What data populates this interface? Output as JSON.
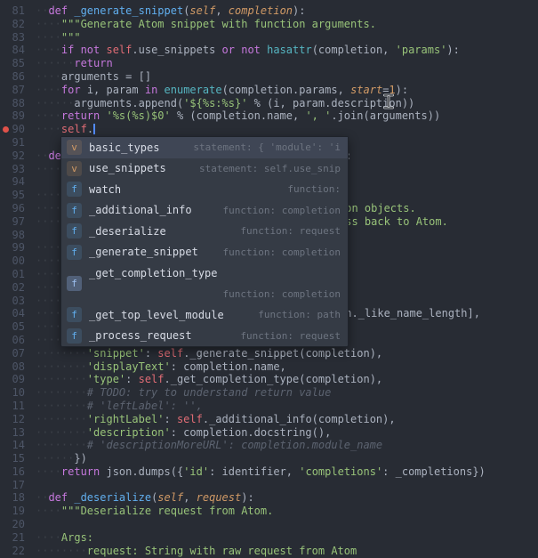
{
  "colors": {
    "background": "#282c34",
    "default_text": "#abb2bf",
    "keyword": "#c678dd",
    "function_name": "#61afef",
    "string": "#98c379",
    "constant": "#d19a66",
    "self_variable": "#e06c75",
    "builtin": "#56b6c2",
    "comment": "#5c6370",
    "gutter": "#4d5566",
    "popup_background": "#353b45",
    "selection_background": "#3f4655",
    "error_dot": "#e0524a",
    "caret": "#528bff"
  },
  "pointer": {
    "type": "ibeam"
  },
  "editor": {
    "lines": [
      {
        "n": "81",
        "t": [
          [
            "ws",
            "··"
          ],
          [
            "kw",
            "def "
          ],
          [
            "fn",
            "_generate_snippet"
          ],
          [
            "fg",
            "("
          ],
          [
            "param",
            "self"
          ],
          [
            "fg",
            ", "
          ],
          [
            "param",
            "completion"
          ],
          [
            "fg",
            "):"
          ]
        ]
      },
      {
        "n": "82",
        "t": [
          [
            "ws",
            "····"
          ],
          [
            "str",
            "\"\"\"Generate Atom snippet with function arguments."
          ]
        ]
      },
      {
        "n": "83",
        "t": [
          [
            "ws",
            "····"
          ],
          [
            "str",
            "\"\"\""
          ]
        ]
      },
      {
        "n": "84",
        "t": [
          [
            "ws",
            "····"
          ],
          [
            "kw",
            "if not "
          ],
          [
            "red",
            "self"
          ],
          [
            "fg",
            ".use_snippets "
          ],
          [
            "kw",
            "or not "
          ],
          [
            "cyan",
            "hasattr"
          ],
          [
            "fg",
            "(completion, "
          ],
          [
            "str",
            "'params'"
          ],
          [
            "fg",
            "):"
          ]
        ]
      },
      {
        "n": "85",
        "t": [
          [
            "ws",
            "······"
          ],
          [
            "kw",
            "return"
          ]
        ]
      },
      {
        "n": "86",
        "t": [
          [
            "ws",
            "····"
          ],
          [
            "fg",
            "arguments = []"
          ]
        ]
      },
      {
        "n": "87",
        "t": [
          [
            "ws",
            "····"
          ],
          [
            "kw",
            "for "
          ],
          [
            "fg",
            "i, param "
          ],
          [
            "kw",
            "in "
          ],
          [
            "cyan",
            "enumerate"
          ],
          [
            "fg",
            "(completion.params, "
          ],
          [
            "param",
            "start"
          ],
          [
            "fg",
            "="
          ],
          [
            "num",
            "1"
          ],
          [
            "fg",
            "):"
          ]
        ]
      },
      {
        "n": "88",
        "t": [
          [
            "ws",
            "······"
          ],
          [
            "fg",
            "arguments.append("
          ],
          [
            "str",
            "'${%s:%s}'"
          ],
          [
            "fg",
            " % (i, param.description))"
          ]
        ]
      },
      {
        "n": "89",
        "t": [
          [
            "ws",
            "····"
          ],
          [
            "kw",
            "return "
          ],
          [
            "str",
            "'%s(%s)$0'"
          ],
          [
            "fg",
            " % (completion.name, "
          ],
          [
            "str",
            "', '"
          ],
          [
            "fg",
            ".join(arguments))"
          ]
        ]
      },
      {
        "n": "90",
        "dot": true,
        "t": [
          [
            "ws",
            "····"
          ],
          [
            "red",
            "self"
          ],
          [
            "fg",
            "."
          ],
          [
            "caret",
            ""
          ]
        ]
      },
      {
        "n": "91",
        "t": []
      },
      {
        "n": "92",
        "t": [
          [
            "ws",
            "··"
          ],
          [
            "kw",
            "de"
          ]
        ],
        "r": {
          "t": [
            [
              "fg",
              "):"
            ]
          ]
        }
      },
      {
        "n": "93",
        "t": [
          [
            "ws",
            "····"
          ]
        ]
      },
      {
        "n": "94",
        "t": []
      },
      {
        "n": "95",
        "t": [
          [
            "ws",
            "····"
          ]
        ]
      },
      {
        "n": "96",
        "t": [
          [
            "ws",
            "····"
          ]
        ],
        "r": {
          "t": [
            [
              "str",
              "ion objects."
            ]
          ]
        }
      },
      {
        "n": "97",
        "t": [
          [
            "ws",
            "····"
          ]
        ],
        "r": {
          "t": [
            [
              "str",
              "ass back to Atom."
            ]
          ]
        }
      },
      {
        "n": "98",
        "t": []
      },
      {
        "n": "99",
        "t": [
          [
            "ws",
            "····"
          ]
        ]
      },
      {
        "n": "00",
        "t": [
          [
            "ws",
            "····"
          ]
        ]
      },
      {
        "n": "01",
        "t": [
          [
            "ws",
            "····"
          ]
        ]
      },
      {
        "n": "02",
        "t": [
          [
            "ws",
            "····"
          ]
        ]
      },
      {
        "n": "03",
        "t": [
          [
            "ws",
            "····"
          ]
        ]
      },
      {
        "n": "04",
        "t": [
          [
            "ws",
            "····"
          ]
        ],
        "r": {
          "t": [
            [
              "fg",
              "on._like_name_length],"
            ]
          ]
        }
      },
      {
        "n": "05",
        "t": [
          [
            "ws",
            "····"
          ]
        ]
      },
      {
        "n": "06",
        "t": [
          [
            "ws",
            "····"
          ]
        ]
      },
      {
        "n": "07",
        "t": [
          [
            "ws",
            "········"
          ],
          [
            "str",
            "'snippet'"
          ],
          [
            "fg",
            ": "
          ],
          [
            "red",
            "self"
          ],
          [
            "fg",
            "._generate_snippet(completion),"
          ]
        ]
      },
      {
        "n": "08",
        "t": [
          [
            "ws",
            "········"
          ],
          [
            "str",
            "'displayText'"
          ],
          [
            "fg",
            ": completion.name,"
          ]
        ]
      },
      {
        "n": "09",
        "t": [
          [
            "ws",
            "········"
          ],
          [
            "str",
            "'type'"
          ],
          [
            "fg",
            ": "
          ],
          [
            "red",
            "self"
          ],
          [
            "fg",
            "._get_completion_type(completion),"
          ]
        ]
      },
      {
        "n": "10",
        "t": [
          [
            "ws",
            "········"
          ],
          [
            "cmt",
            "# TODO: try to understand return value"
          ]
        ]
      },
      {
        "n": "11",
        "t": [
          [
            "ws",
            "········"
          ],
          [
            "cmt",
            "# 'leftLabel': '',"
          ]
        ]
      },
      {
        "n": "12",
        "t": [
          [
            "ws",
            "········"
          ],
          [
            "str",
            "'rightLabel'"
          ],
          [
            "fg",
            ": "
          ],
          [
            "red",
            "self"
          ],
          [
            "fg",
            "._additional_info(completion),"
          ]
        ]
      },
      {
        "n": "13",
        "t": [
          [
            "ws",
            "········"
          ],
          [
            "str",
            "'description'"
          ],
          [
            "fg",
            ": completion.docstring(),"
          ]
        ]
      },
      {
        "n": "14",
        "t": [
          [
            "ws",
            "········"
          ],
          [
            "cmt",
            "# 'descriptionMoreURL': completion.module_name"
          ]
        ]
      },
      {
        "n": "15",
        "t": [
          [
            "ws",
            "······"
          ],
          [
            "fg",
            "})"
          ]
        ]
      },
      {
        "n": "16",
        "t": [
          [
            "ws",
            "····"
          ],
          [
            "kw",
            "return "
          ],
          [
            "fg",
            "json.dumps({"
          ],
          [
            "str",
            "'id'"
          ],
          [
            "fg",
            ": identifier, "
          ],
          [
            "str",
            "'completions'"
          ],
          [
            "fg",
            ": _completions})"
          ]
        ]
      },
      {
        "n": "17",
        "t": []
      },
      {
        "n": "18",
        "t": [
          [
            "ws",
            "··"
          ],
          [
            "kw",
            "def "
          ],
          [
            "fn",
            "_deserialize"
          ],
          [
            "fg",
            "("
          ],
          [
            "param",
            "self"
          ],
          [
            "fg",
            ", "
          ],
          [
            "param",
            "request"
          ],
          [
            "fg",
            "):"
          ]
        ]
      },
      {
        "n": "19",
        "t": [
          [
            "ws",
            "····"
          ],
          [
            "str",
            "\"\"\"Deserialize request from Atom."
          ]
        ]
      },
      {
        "n": "20",
        "t": []
      },
      {
        "n": "21",
        "t": [
          [
            "ws",
            "····"
          ],
          [
            "str",
            "Args:"
          ]
        ]
      },
      {
        "n": "22",
        "t": [
          [
            "ws",
            "········"
          ],
          [
            "str",
            "request: String with raw request from Atom"
          ]
        ]
      }
    ]
  },
  "popup": {
    "items": [
      {
        "icon": "v",
        "kind": "variable",
        "name": "basic_types",
        "right": "statement: { 'module': 'i",
        "selected": true
      },
      {
        "icon": "v",
        "kind": "variable",
        "name": "use_snippets",
        "right": "statement: self.use_snip"
      },
      {
        "icon": "f",
        "kind": "function",
        "name": "watch",
        "right": "function:"
      },
      {
        "icon": "f",
        "kind": "function",
        "name": "_additional_info",
        "right": "function: completion"
      },
      {
        "icon": "f",
        "kind": "function",
        "name": "_deserialize",
        "right": "function: request"
      },
      {
        "icon": "f",
        "kind": "function",
        "name": "_generate_snippet",
        "right": "function: completion"
      },
      {
        "icon": "f",
        "kind": "function",
        "name": "_get_completion_type",
        "right": "function: completion",
        "tall": true
      },
      {
        "icon": "f",
        "kind": "function",
        "name": "_get_top_level_module",
        "right": "function: path"
      },
      {
        "icon": "f",
        "kind": "function",
        "name": "_process_request",
        "right": "function: request"
      }
    ]
  }
}
